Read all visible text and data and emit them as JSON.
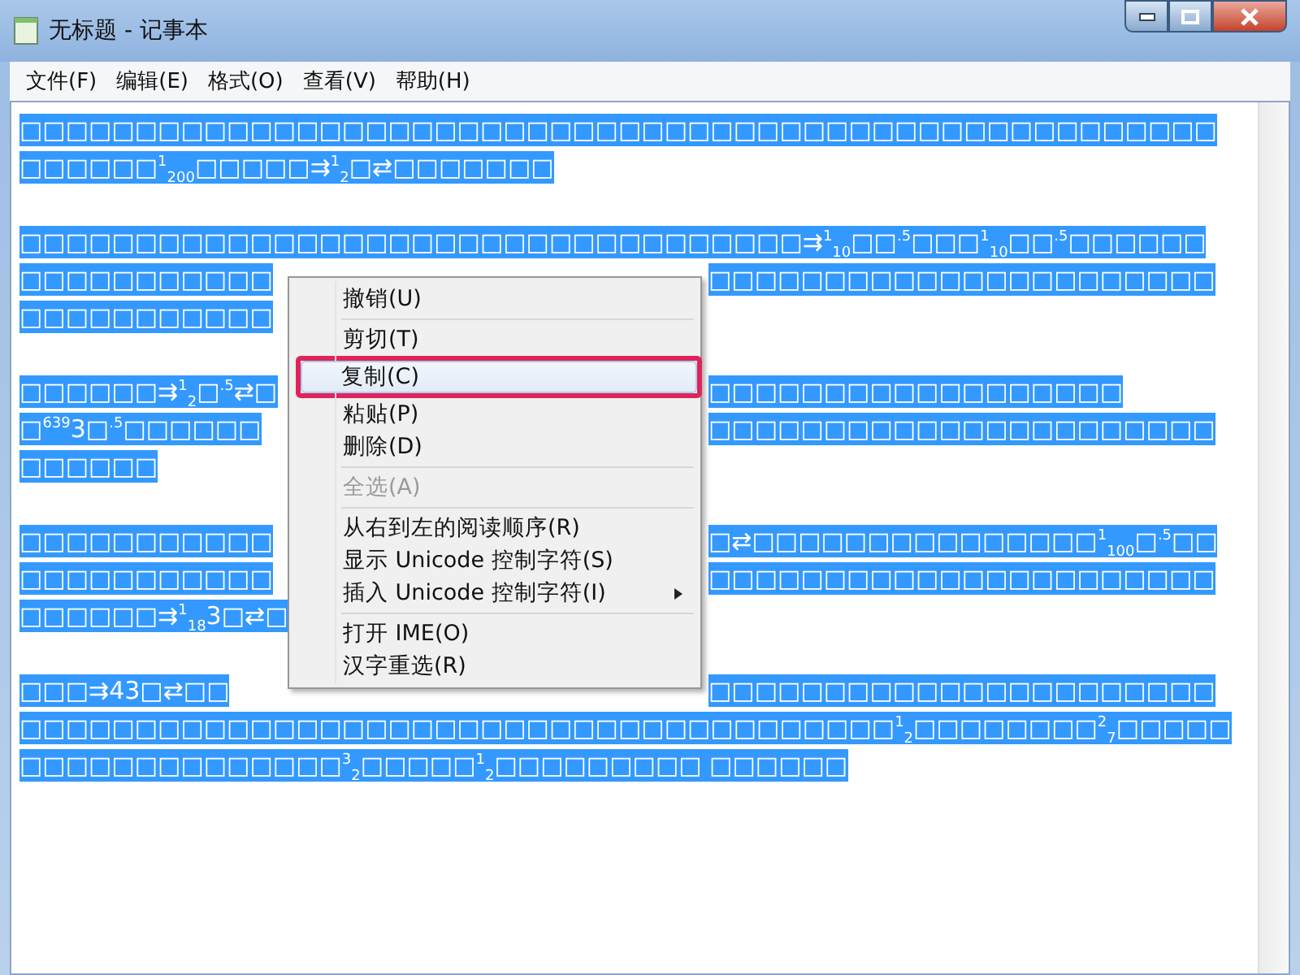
{
  "window": {
    "title": "无标题 - 记事本"
  },
  "menu_bar": [
    "文件(F)",
    "编辑(E)",
    "格式(O)",
    "查看(V)",
    "帮助(H)"
  ],
  "editor": {
    "text_selected": true,
    "paragraphs": [
      {
        "lines": [
          {
            "left": "□□□□□□□□□□□□□□□□□□□□□□□□□□□□□□□□□□□□□□□□□□□□□□□□□□□□"
          },
          {
            "left": "□□□□□□$^{1}$$_{200}$□□□□□⇉$^{1}$$_{2}$□⇄□□□□□□□"
          }
        ]
      },
      {
        "lines": [
          {
            "left": "□□□□□□□□□□□□□□□□□□□□□□□□□□□□□□□□□□⇉$^{1}$$_{10}$□□$^{.5}$□□□$^{1}$$_{10}$□□$^{.5}$□□□□□□"
          },
          {
            "left": "□□□□□□□□□□□",
            "right": "□□□□□□□□□□□□□□□□□□□□□□"
          },
          {
            "left": "□□□□□□□□□□□"
          }
        ]
      },
      {
        "lines": [
          {
            "left": "□□□□□□⇉$^{1}$$_{2}$□$^{.5}$⇄□",
            "right": "□□□□□□□□□□□□□□□□□□"
          },
          {
            "left": "□$^{639}$3□$^{.5}$□□□□□□",
            "right": "□□□□□□□□□□□□□□□□□□□□□□"
          },
          {
            "left": "□□□□□□"
          }
        ]
      },
      {
        "lines": [
          {
            "left": "□□□□□□□□□□□",
            "right": "□⇄□□□□□□□□□□□□□□□$^{1}$$_{100}$□$^{.5}$□□"
          },
          {
            "left": "□□□□□□□□□□□",
            "right": "□□□□□□□□□□□□□□□□□□□□□□"
          },
          {
            "left": "□□□□□□⇉$^{1}$$_{18}$3□⇄□"
          }
        ]
      },
      {
        "lines": [
          {
            "left": "□□□⇉43□⇄□□",
            "right": "□□□□□□□□□□□□□□□□□□□□□□"
          },
          {
            "left": "□□□□□□□□□□□□□□□□□□□□□□□□□□□□□□□□□□□□□□$^{1}$$_{2}$□□□□□□□□$^{2}$$_{7}$□□□□□"
          },
          {
            "left": "□□□□□□□□□□□□□□$^{3}$$_{2}$□□□□□$^{1}$$_{2}$□□□□□□□□□ □□□□□□"
          }
        ]
      }
    ]
  },
  "context_menu": {
    "groups": [
      [
        {
          "label": "撤销(U)",
          "disabled": false,
          "selected": false
        }
      ],
      [
        {
          "label": "剪切(T)",
          "disabled": false,
          "selected": false
        },
        {
          "label": "复制(C)",
          "disabled": false,
          "selected": true,
          "outlined": true
        },
        {
          "label": "粘贴(P)",
          "disabled": false,
          "selected": false
        },
        {
          "label": "删除(D)",
          "disabled": false,
          "selected": false
        }
      ],
      [
        {
          "label": "全选(A)",
          "disabled": true,
          "selected": false
        }
      ],
      [
        {
          "label": "从右到左的阅读顺序(R)",
          "disabled": false,
          "selected": false
        },
        {
          "label": "显示 Unicode 控制字符(S)",
          "disabled": false,
          "selected": false
        },
        {
          "label": "插入 Unicode 控制字符(I)",
          "disabled": false,
          "selected": false,
          "submenu": true
        }
      ],
      [
        {
          "label": "打开 IME(O)",
          "disabled": false,
          "selected": false
        },
        {
          "label": "汉字重选(R)",
          "disabled": false,
          "selected": false
        }
      ]
    ]
  }
}
